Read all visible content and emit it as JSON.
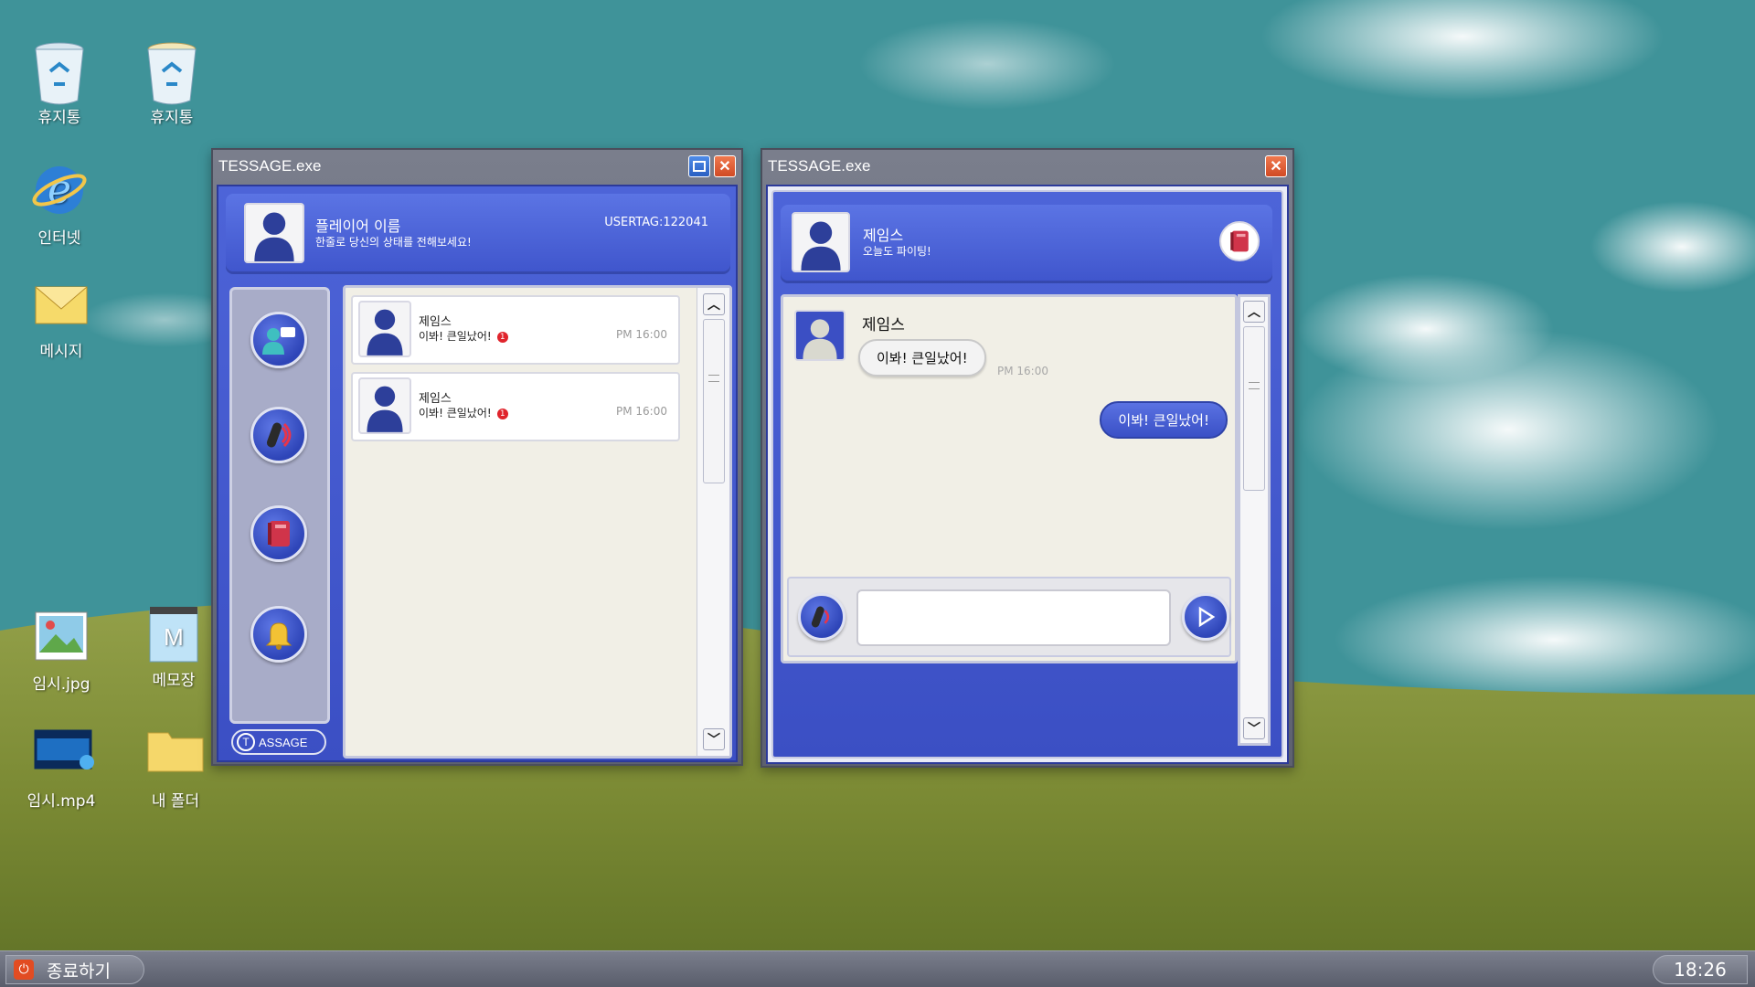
{
  "desktop": {
    "icons": [
      {
        "label": "휴지통",
        "icon": "recycle-bin-empty"
      },
      {
        "label": "휴지통",
        "icon": "recycle-bin-full"
      },
      {
        "label": "인터넷",
        "icon": "internet-explorer"
      },
      {
        "label": "메시지",
        "icon": "envelope"
      },
      {
        "label": "임시.jpg",
        "icon": "image-file"
      },
      {
        "label": "메모장",
        "icon": "notepad"
      },
      {
        "label": "임시.mp4",
        "icon": "video-file"
      },
      {
        "label": "내 폴더",
        "icon": "folder"
      }
    ]
  },
  "window_left": {
    "title": "TESSAGE.exe",
    "profile": {
      "name": "플레이어 이름",
      "status": "한줄로 당신의 상태를 전해보세요!",
      "usertag": "USERTAG:122041"
    },
    "nav_icons": [
      "friends-chat-icon",
      "voice-record-icon",
      "notebook-icon",
      "bell-icon"
    ],
    "logo_text": "ASSAGE",
    "chats": [
      {
        "name": "제임스",
        "message": "이봐! 큰일났어!",
        "unread": "1",
        "time": "PM 16:00"
      },
      {
        "name": "제임스",
        "message": "이봐! 큰일났어!",
        "unread": "1",
        "time": "PM 16:00"
      }
    ]
  },
  "window_right": {
    "title": "TESSAGE.exe",
    "contact": {
      "name": "제임스",
      "status": "오늘도 파이팅!"
    },
    "messages": [
      {
        "sender": "제임스",
        "text": "이봐! 큰일났어!",
        "time": "PM 16:00"
      },
      {
        "text": "이봐! 큰일났어!"
      }
    ],
    "input_value": ""
  },
  "taskbar": {
    "start_label": "종료하기",
    "clock": "18:26"
  },
  "colors": {
    "accent": "#4a60d6",
    "close": "#e05a30",
    "panel": "#f1efe6"
  }
}
